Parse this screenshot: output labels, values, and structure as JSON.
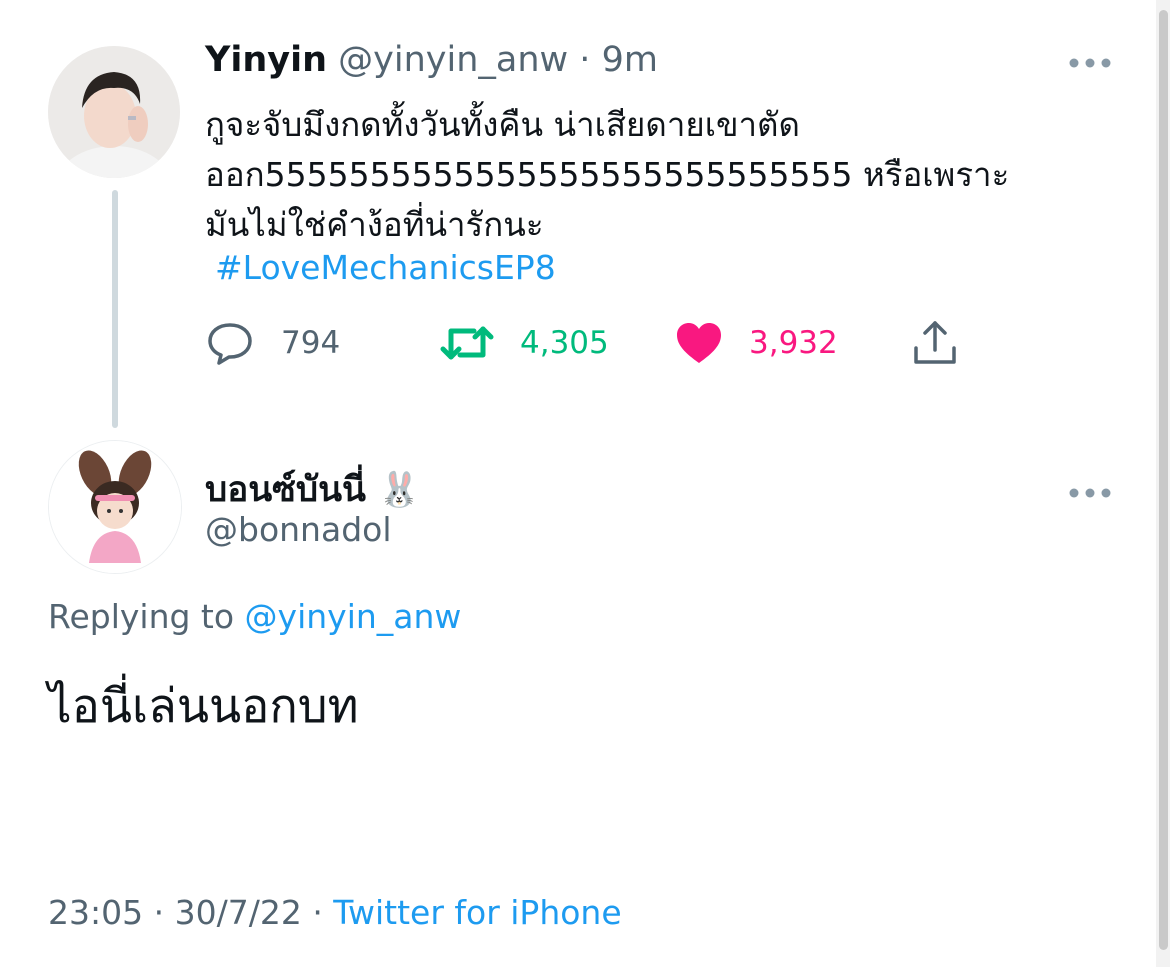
{
  "tweet": {
    "author_name": "Yinyin",
    "author_handle": "@yinyin_anw",
    "separator": "·",
    "time_ago": "9m",
    "text": "กูจะจับมึงกดทั้งวันทั้งคืน น่าเสียดายเขาตัด\nออก5555555555555555555555555555 หรือเพราะ\nมันไม่ใช่คำง้อที่น่ารักนะ",
    "hashtag": "#LoveMechanicsEP8",
    "replies": "794",
    "retweets": "4,305",
    "likes": "3,932",
    "more_icon": "more-horizontal-icon"
  },
  "reply": {
    "author_name": "บอนซ์บันนี่",
    "emoji": "🐰",
    "author_handle": "@bonnadol",
    "replying_prefix": "Replying to",
    "replying_to": "@yinyin_anw",
    "text": "ไอนี่เล่นนอกบท",
    "time": "23:05",
    "date": "30/7/22",
    "source": "Twitter for iPhone",
    "more_icon": "more-horizontal-icon"
  },
  "colors": {
    "link": "#1d9bf0",
    "retweet": "#00ba7c",
    "like": "#f91880",
    "muted": "#536471",
    "text": "#0f1419"
  }
}
